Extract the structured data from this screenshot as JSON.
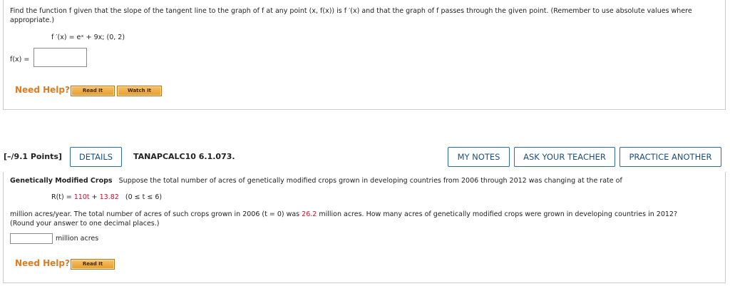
{
  "q1": {
    "prompt": "Find the function f given that the slope of the tangent line to the graph of f at any point (x, f(x)) is f ′(x) and that the graph of f passes through the given point. (Remember to use absolute values where appropriate.)",
    "given": "f ′(x) = eˣ + 9x;   (0, 2)",
    "answer_label": "f(x) =",
    "answer_value": "",
    "need_help": "Need Help?",
    "read_it": "Read It",
    "watch_it": "Watch It"
  },
  "q2": {
    "points": "[–/9.1 Points]",
    "details": "DETAILS",
    "id": "TANAPCALC10 6.1.073.",
    "my_notes": "MY NOTES",
    "ask_teacher": "ASK YOUR TEACHER",
    "practice_another": "PRACTICE ANOTHER",
    "title": "Genetically Modified Crops",
    "intro": "Suppose the total number of acres of genetically modified crops grown in developing countries from 2006 through 2012 was changing at the rate of",
    "rate_lhs": "R(t) = ",
    "rate_a": "110t",
    "rate_plus": " + ",
    "rate_b": "13.82",
    "rate_domain": "(0 ≤ t ≤ 6)",
    "body_1": "million acres/year. The total number of acres of such crops grown in 2006 (t = 0) was ",
    "body_value": "26.2",
    "body_2": " million acres. How many acres of genetically modified crops were grown in developing countries in 2012?",
    "body_3": "(Round your answer to one decimal places.)",
    "answer_value": "",
    "answer_unit": "million acres",
    "need_help": "Need Help?",
    "read_it": "Read It"
  },
  "colors": {
    "accent_orange": "#e07b1f",
    "link_blue": "#1d4f7c",
    "highlight_red": "#c8102e"
  }
}
